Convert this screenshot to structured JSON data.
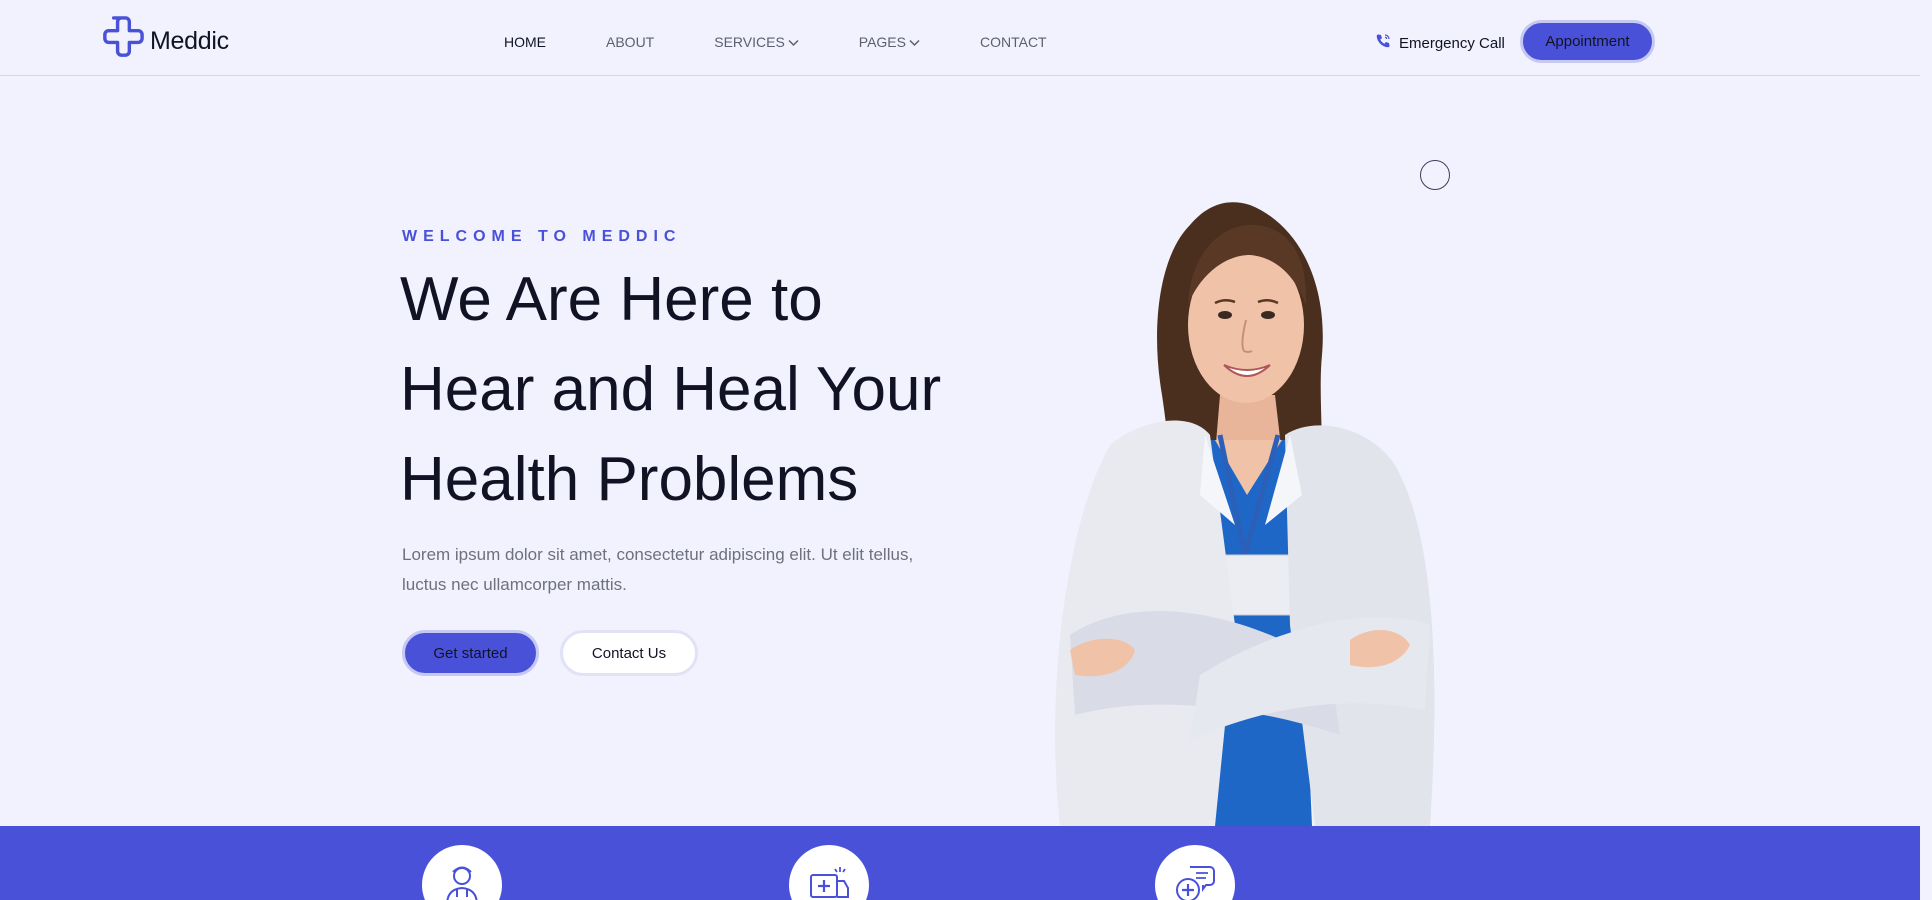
{
  "brand": {
    "name": "Meddic",
    "logo_icon": "medical-cross-icon",
    "accent": "#4a51d9"
  },
  "nav": {
    "items": [
      {
        "label": "HOME",
        "active": true
      },
      {
        "label": "ABOUT",
        "active": false
      },
      {
        "label": "SERVICES",
        "active": false,
        "has_dropdown": true
      },
      {
        "label": "PAGES",
        "active": false,
        "has_dropdown": true
      },
      {
        "label": "CONTACT",
        "active": false
      }
    ]
  },
  "header": {
    "emergency_label": "Emergency Call",
    "emergency_icon": "phone-icon",
    "appointment_label": "Appointment"
  },
  "hero": {
    "eyebrow": "WELCOME TO MEDDIC",
    "headline_lines": [
      "We Are Here to",
      "Hear and Heal Your",
      "Health Problems"
    ],
    "lede": "Lorem ipsum dolor sit amet, consectetur adipiscing elit. Ut elit tellus, luctus nec ullamcorper mattis.",
    "primary_cta": "Get started",
    "secondary_cta": "Contact Us",
    "image": "doctor-portrait"
  },
  "features": {
    "icons": [
      "doctor-icon",
      "ambulance-icon",
      "medical-chat-icon"
    ]
  },
  "colors": {
    "background": "#f1f2fd",
    "accent": "#4a51d9",
    "heading": "#111325",
    "body_text": "#6e7080"
  }
}
